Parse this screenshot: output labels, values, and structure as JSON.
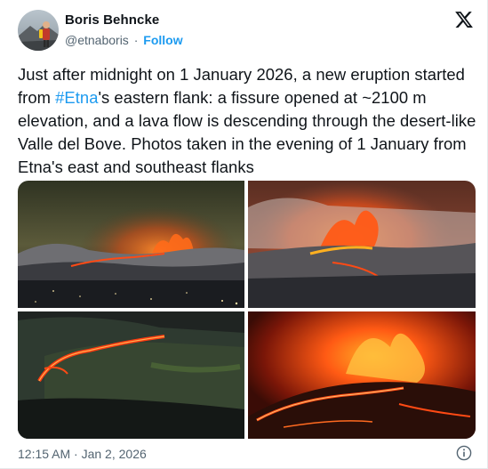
{
  "author": {
    "name": "Boris Behncke",
    "handle": "@etnaboris",
    "separator": "·",
    "follow_label": "Follow"
  },
  "tweet": {
    "text_before": "Just after midnight on 1 January 2026, a new eruption started from ",
    "hashtag": "#Etna",
    "text_after": "'s eastern flank: a fissure opened at ~2100 m elevation, and a lava flow is descending through the desert-like Valle del Bove. Photos taken in the evening of 1 January from Etna's east and southeast flanks",
    "timestamp": "12:15 AM · Jan 2, 2026"
  },
  "icons": {
    "logo": "x-logo-icon",
    "info": "info-icon"
  },
  "colors": {
    "link": "#1d9bf0",
    "secondary_text": "#536471",
    "primary_text": "#0f1419",
    "lava": "#ff4a14"
  }
}
